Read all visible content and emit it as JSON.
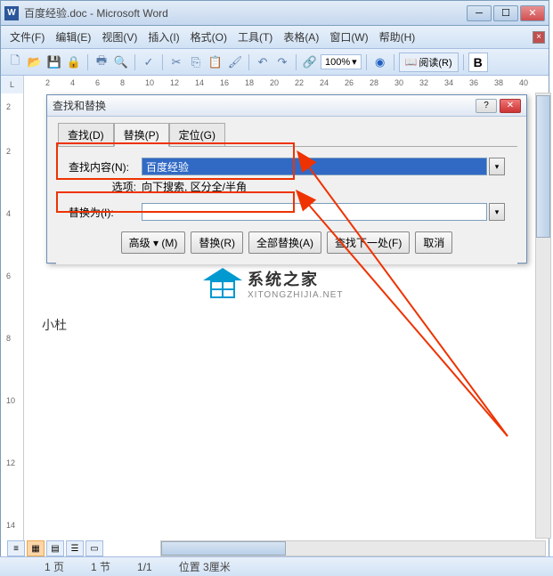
{
  "window": {
    "title": "百度经验.doc - Microsoft Word",
    "app_icon": "W"
  },
  "menu": {
    "file": "文件(F)",
    "edit": "编辑(E)",
    "view": "视图(V)",
    "insert": "插入(I)",
    "format": "格式(O)",
    "tools": "工具(T)",
    "table": "表格(A)",
    "window": "窗口(W)",
    "help": "帮助(H)"
  },
  "toolbar": {
    "zoom": "100%",
    "read": "阅读(R)",
    "bold": "B"
  },
  "ruler": {
    "corner": "L",
    "h": [
      "2",
      "4",
      "6",
      "8",
      "10",
      "12",
      "14",
      "16",
      "18",
      "20",
      "22",
      "24",
      "26",
      "28",
      "30",
      "32",
      "34",
      "36",
      "38",
      "40"
    ],
    "v": [
      "2",
      "2",
      "4",
      "6",
      "8",
      "10",
      "12",
      "14"
    ]
  },
  "dialog": {
    "title": "查找和替换",
    "tabs": {
      "find": "查找(D)",
      "replace": "替换(P)",
      "goto": "定位(G)"
    },
    "find_label": "查找内容(N):",
    "find_value": "百度经验",
    "options_label": "选项:",
    "options_value": "向下搜索, 区分全/半角",
    "replace_label": "替换为(I):",
    "replace_value": "",
    "buttons": {
      "more": "高级 ▾ (M)",
      "replace": "替换(R)",
      "replace_all": "全部替换(A)",
      "find_next": "查找下一处(F)",
      "cancel": "取消"
    }
  },
  "doc": {
    "text1": "小杜"
  },
  "logo": {
    "cn": "系统之家",
    "en": "XITONGZHIJIA.NET"
  },
  "status": {
    "page": "1 页",
    "section": "1 节",
    "pages": "1/1",
    "position": "位置 3厘米"
  }
}
